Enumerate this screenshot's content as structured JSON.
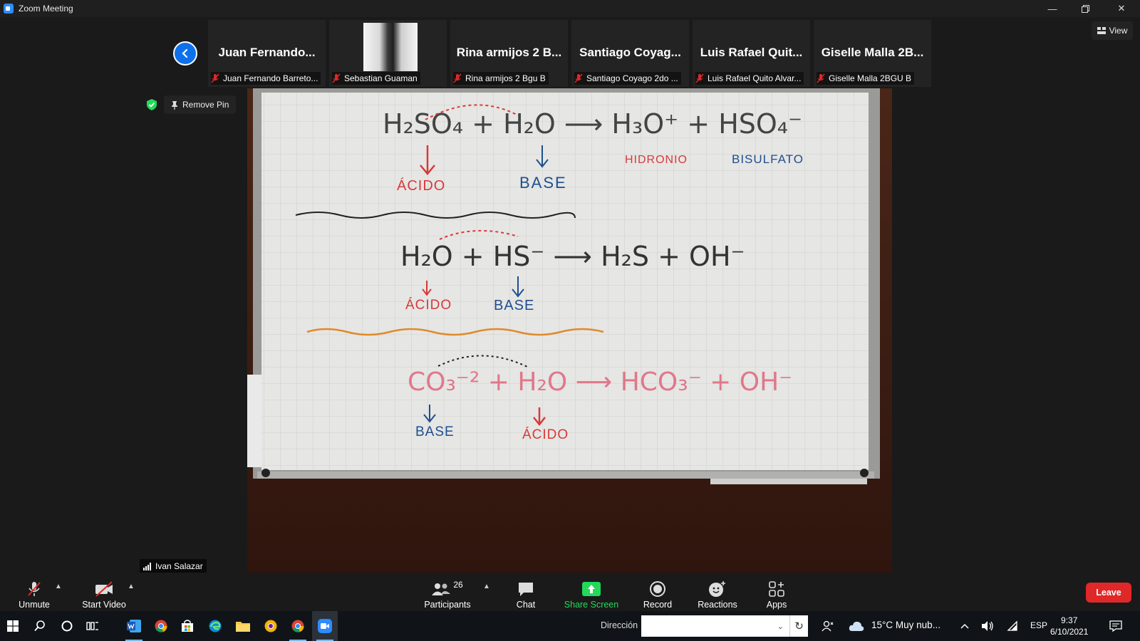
{
  "window": {
    "title": "Zoom Meeting"
  },
  "view_button": {
    "label": "View"
  },
  "participants_strip": [
    {
      "tile_name": "Juan Fernando...",
      "label": "Juan Fernando Barreto...",
      "has_video": false
    },
    {
      "tile_name": "",
      "label": "Sebastian Guaman",
      "has_video": true
    },
    {
      "tile_name": "Rina armijos 2 B...",
      "label": "Rina armijos 2 Bgu B",
      "has_video": false
    },
    {
      "tile_name": "Santiago Coyag...",
      "label": "Santiago Coyago 2do ...",
      "has_video": false
    },
    {
      "tile_name": "Luis Rafael Quit...",
      "label": "Luis Rafael Quito Alvar...",
      "has_video": false
    },
    {
      "tile_name": "Giselle Malla 2B...",
      "label": "Giselle Malla 2BGU B",
      "has_video": false
    }
  ],
  "pin": {
    "remove_label": "Remove Pin"
  },
  "speaker": {
    "name": "Ivan Salazar"
  },
  "whiteboard": {
    "eq1": {
      "text": "H₂SO₄ + H₂O ⟶ H₃O⁺ + HSO₄⁻",
      "acid": "ÁCIDO",
      "base": "BASE",
      "product1": "HIDRONIO",
      "product2": "BISULFATO"
    },
    "eq2": {
      "text": "H₂O + HS⁻ ⟶ H₂S + OH⁻",
      "acid": "ÁCIDO",
      "base": "BASE"
    },
    "eq3": {
      "text": "CO₃⁻² + H₂O ⟶ HCO₃⁻ + OH⁻",
      "base": "BASE",
      "acid": "ÁCIDO"
    }
  },
  "toolbar": {
    "unmute": "Unmute",
    "start_video": "Start Video",
    "participants": "Participants",
    "participants_count": "26",
    "chat": "Chat",
    "share_screen": "Share Screen",
    "record": "Record",
    "reactions": "Reactions",
    "apps": "Apps",
    "leave": "Leave"
  },
  "taskbar": {
    "address_label": "Dirección",
    "weather": "15°C  Muy nub...",
    "language": "ESP",
    "time": "9:37",
    "date": "6/10/2021"
  },
  "colors": {
    "zoom_blue": "#0e71eb",
    "share_green": "#23d959",
    "leave_red": "#e02828"
  }
}
